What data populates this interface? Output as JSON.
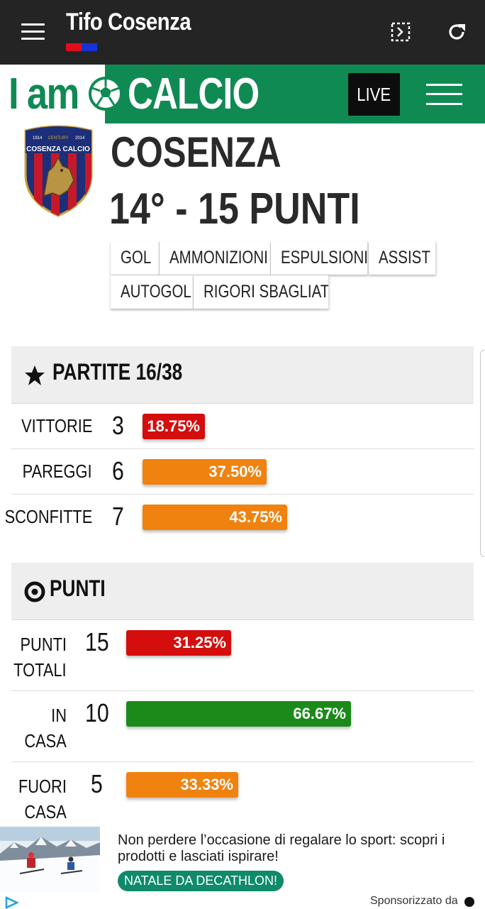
{
  "appbar": {
    "title": "Tifo Cosenza"
  },
  "site": {
    "logo_left": "I am",
    "logo_right": "CALCIO",
    "live_label": "LIVE"
  },
  "team": {
    "name": "COSENZA",
    "position_line": "14° - 15 PUNTI",
    "crest_text": "COSENZA CALCIO",
    "crest_year_left": "1914",
    "crest_year_right": "2014",
    "crest_small": "CENTURY"
  },
  "tabs": [
    "GOL",
    "AMMONIZIONI",
    "ESPULSIONI",
    "ASSIST",
    "AUTOGOL",
    "RIGORI SBAGLIATI"
  ],
  "partite": {
    "title": "PARTITE 16/38",
    "rows": [
      {
        "label": "VITTORIE",
        "value": "3",
        "percent": "18.75%",
        "fraction": 0.1875,
        "color": "#d40d0d"
      },
      {
        "label": "PAREGGI",
        "value": "6",
        "percent": "37.50%",
        "fraction": 0.375,
        "color": "#f0820f"
      },
      {
        "label": "SCONFITTE",
        "value": "7",
        "percent": "43.75%",
        "fraction": 0.4375,
        "color": "#f0820f"
      }
    ]
  },
  "punti": {
    "title": "PUNTI",
    "rows": [
      {
        "label_1": "PUNTI",
        "label_2": "TOTALI",
        "value": "15",
        "percent": "31.25%",
        "fraction": 0.3125,
        "color": "#d40d0d"
      },
      {
        "label_1": "IN",
        "label_2": "CASA",
        "value": "10",
        "percent": "66.67%",
        "fraction": 0.6667,
        "color": "#1b8a1b"
      },
      {
        "label_1": "FUORI",
        "label_2": "CASA",
        "value": "5",
        "percent": "33.33%",
        "fraction": 0.3333,
        "color": "#f0820f"
      }
    ]
  },
  "ad": {
    "text": "Non perdere l’occasione di regalare lo sport: scopri i prodotti e lasciati ispirare!",
    "cta": "NATALE DA DECATHLON!",
    "sponsored": "Sponsorizzato da"
  }
}
